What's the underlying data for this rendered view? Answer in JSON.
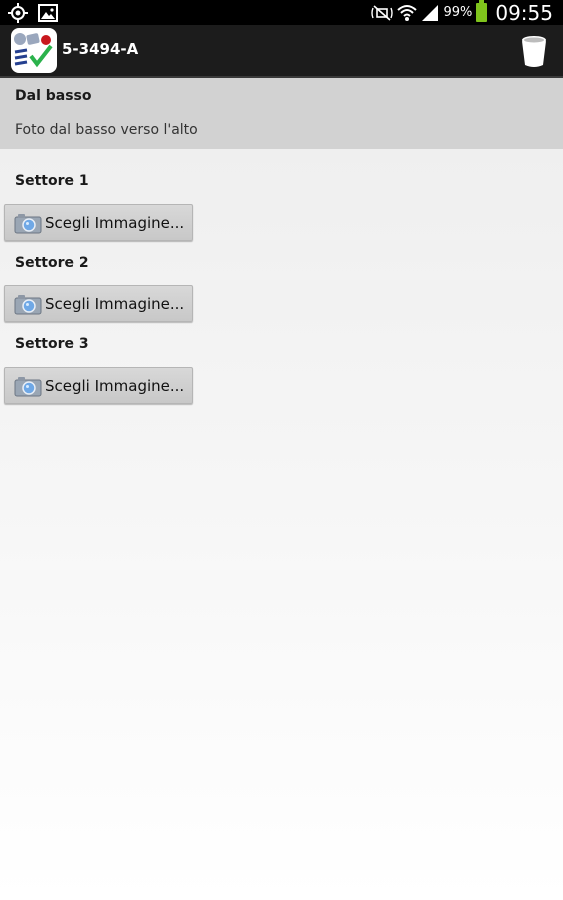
{
  "status_bar": {
    "battery_percent": "99%",
    "time": "09:55",
    "icons": [
      "location-icon",
      "image-notification-icon",
      "mute-icon",
      "wifi-icon",
      "signal-icon",
      "battery-icon"
    ],
    "battery_color": "#7fc41c"
  },
  "action_bar": {
    "title": "5-3494-A",
    "app_icon": "app-logo-icon",
    "action_icon": "trash-icon"
  },
  "header": {
    "title": "Dal basso",
    "subtitle": "Foto dal basso verso l'alto"
  },
  "sectors": [
    {
      "label": "Settore 1",
      "button_label": "Scegli Immagine..."
    },
    {
      "label": "Settore 2",
      "button_label": "Scegli Immagine..."
    },
    {
      "label": "Settore 3",
      "button_label": "Scegli Immagine..."
    }
  ]
}
